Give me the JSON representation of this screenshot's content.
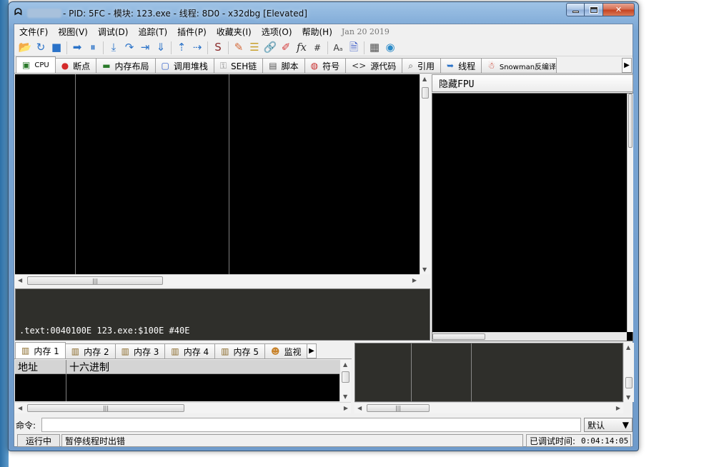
{
  "window": {
    "title": " - PID: 5FC - 模块: 123.exe - 线程: 8D0 - x32dbg [Elevated]",
    "app_icon": "bug-icon"
  },
  "menu": {
    "items": [
      "文件(F)",
      "视图(V)",
      "调试(D)",
      "追踪(T)",
      "插件(P)",
      "收藏夹(I)",
      "选项(O)",
      "帮助(H)"
    ],
    "date": "Jan 20 2019"
  },
  "toolbar": {
    "icons": [
      {
        "name": "open-icon",
        "glyph": "📂"
      },
      {
        "name": "restart-icon",
        "glyph": "↻"
      },
      {
        "name": "stop-icon",
        "glyph": "■"
      },
      {
        "name": "run-icon",
        "glyph": "➡"
      },
      {
        "name": "pause-icon",
        "glyph": "⏸"
      },
      {
        "name": "step-into-icon",
        "glyph": "⤓"
      },
      {
        "name": "step-over-icon",
        "glyph": "↷"
      },
      {
        "name": "trace-into-icon",
        "glyph": "⇥"
      },
      {
        "name": "trace-over-icon",
        "glyph": "⇓"
      },
      {
        "name": "execute-till-return-icon",
        "glyph": "⇡"
      },
      {
        "name": "run-to-user-code-icon",
        "glyph": "⇢"
      },
      {
        "name": "scylla-icon",
        "glyph": "S"
      },
      {
        "name": "patches-icon",
        "glyph": "✎"
      },
      {
        "name": "comments-icon",
        "glyph": "☰"
      },
      {
        "name": "labels-icon",
        "glyph": "🔗"
      },
      {
        "name": "bookmarks-icon",
        "glyph": "✐"
      },
      {
        "name": "functions-icon",
        "glyph": "fx"
      },
      {
        "name": "hash-icon",
        "glyph": "#"
      },
      {
        "name": "strings-icon",
        "glyph": "Aₐ"
      },
      {
        "name": "script-icon",
        "glyph": "🗎"
      },
      {
        "name": "calculator-icon",
        "glyph": "▦"
      },
      {
        "name": "globe-icon",
        "glyph": "◉"
      }
    ]
  },
  "tabs": [
    {
      "label": "CPU",
      "icon": "cpu-icon",
      "glyph": "▣"
    },
    {
      "label": "断点",
      "icon": "breakpoint-icon",
      "glyph": "●"
    },
    {
      "label": "内存布局",
      "icon": "memory-map-icon",
      "glyph": "▬"
    },
    {
      "label": "调用堆栈",
      "icon": "call-stack-icon",
      "glyph": "▢"
    },
    {
      "label": "SEH链",
      "icon": "seh-icon",
      "glyph": "⚿"
    },
    {
      "label": "脚本",
      "icon": "script-tab-icon",
      "glyph": "▤"
    },
    {
      "label": "符号",
      "icon": "symbols-icon",
      "glyph": "◍"
    },
    {
      "label": "源代码",
      "icon": "source-icon",
      "glyph": "<>"
    },
    {
      "label": "引用",
      "icon": "references-icon",
      "glyph": "⌕"
    },
    {
      "label": "线程",
      "icon": "threads-icon",
      "glyph": "➥"
    },
    {
      "label": "Snowman反编译器",
      "icon": "snowman-icon",
      "glyph": "☃"
    }
  ],
  "registers": {
    "header": "隐藏FPU"
  },
  "info": {
    "text": ".text:0040100E 123.exe:$100E #40E"
  },
  "memory_tabs": [
    {
      "label": "内存 1",
      "icon": "memory-dump-icon"
    },
    {
      "label": "内存 2",
      "icon": "memory-dump-icon"
    },
    {
      "label": "内存 3",
      "icon": "memory-dump-icon"
    },
    {
      "label": "内存 4",
      "icon": "memory-dump-icon"
    },
    {
      "label": "内存 5",
      "icon": "memory-dump-icon"
    },
    {
      "label": "监视",
      "icon": "watch-icon"
    }
  ],
  "dump": {
    "col_address": "地址",
    "col_hex": "十六进制"
  },
  "command": {
    "label": "命令:",
    "value": "",
    "select_value": "默认"
  },
  "status": {
    "state": "运行中",
    "message": "暂停线程时出错",
    "time_label": "已调试时间:",
    "time_value": "0:04:14:05"
  },
  "colors": {
    "pane_black": "#000000",
    "pane_dark": "#2f2f2b",
    "accent": "#7aa6d4"
  }
}
